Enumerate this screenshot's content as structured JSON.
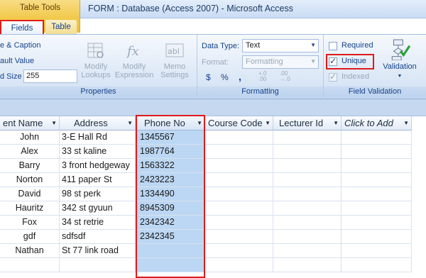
{
  "titlebar": {
    "context_group": "Table Tools",
    "title": "FORM : Database (Access 2007)  -  Microsoft Access"
  },
  "tabs": [
    {
      "label": "Fields"
    },
    {
      "label": "Table"
    }
  ],
  "properties": {
    "name_caption": "e & Caption",
    "default_value": "ault Value",
    "field_size_label": "d Size",
    "field_size_value": "255",
    "modify_lookups": [
      "Modify",
      "Lookups"
    ],
    "modify_expression": [
      "Modify",
      "Expression"
    ],
    "memo_settings": [
      "Memo",
      "Settings"
    ],
    "group_label": "Properties"
  },
  "formatting": {
    "data_type_label": "Data Type:",
    "data_type_value": "Text",
    "format_label": "Format:",
    "format_value": "Formatting",
    "currency_symbol": "$",
    "percent_symbol": "%",
    "comma_symbol": ",",
    "increase_decimals": "+.0 .00",
    "decrease_decimals": ".00 →.0",
    "group_label": "Formatting"
  },
  "validation": {
    "required_label": "Required",
    "unique_label": "Unique",
    "indexed_label": "Indexed",
    "validation_button": "Validation",
    "group_label": "Field Validation",
    "required_checked": false,
    "unique_checked": true,
    "indexed_checked": true
  },
  "table": {
    "columns": [
      "ent Name",
      "Address",
      "Phone No",
      "Course Code",
      "Lecturer Id",
      "Click to Add"
    ],
    "rows": [
      [
        "John",
        "3-E Hall Rd",
        "1345567"
      ],
      [
        "Alex",
        "33 st kaline",
        "1987764"
      ],
      [
        "Barry",
        "3 front hedgeway",
        "1563322"
      ],
      [
        "Norton",
        "411 paper St",
        "2423223"
      ],
      [
        "David",
        "98 st perk",
        "1334490"
      ],
      [
        "Hauritz",
        "342 st gyuun",
        "8945309"
      ],
      [
        "Fox",
        "34 st retrie",
        "2342342"
      ],
      [
        "gdf",
        "sdfsdf",
        "2342345"
      ],
      [
        "Nathan",
        "St 77 link road",
        ""
      ]
    ]
  },
  "colors": {
    "highlight_border": "#e01b1b",
    "selected_column": "#bcd7f3",
    "ribbon_text": "#15428b"
  }
}
